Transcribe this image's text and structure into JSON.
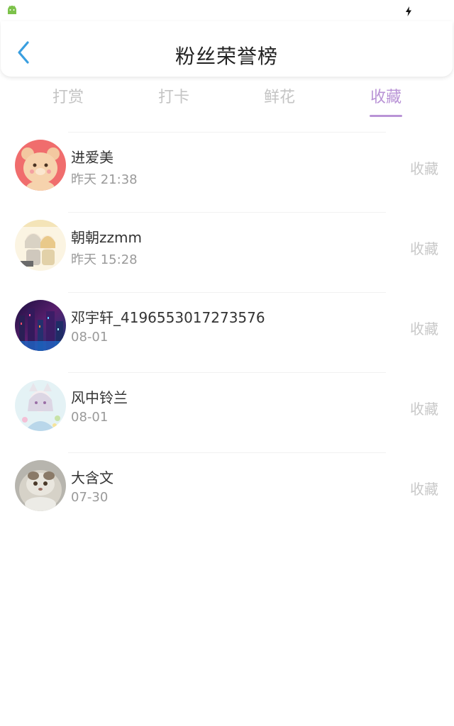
{
  "header": {
    "title": "粉丝荣誉榜"
  },
  "tabs": [
    {
      "label": "打赏",
      "active": false
    },
    {
      "label": "打卡",
      "active": false
    },
    {
      "label": "鲜花",
      "active": false
    },
    {
      "label": "收藏",
      "active": true
    }
  ],
  "colors": {
    "accent": "#b993d6",
    "back_arrow": "#3a9fe0",
    "tab_inactive": "#c4c4c4",
    "secondary_text": "#9a9a9a"
  },
  "fans": [
    {
      "name": "进爱美",
      "time": "昨天 21:38",
      "action": "收藏",
      "avatar": "bear-avatar"
    },
    {
      "name": "朝朝zzmm",
      "time": "昨天 15:28",
      "action": "收藏",
      "avatar": "anime-couple-avatar"
    },
    {
      "name": "邓宇轩_4196553017273576",
      "time": "08-01",
      "action": "收藏",
      "avatar": "city-night-avatar"
    },
    {
      "name": "风中铃兰",
      "time": "08-01",
      "action": "收藏",
      "avatar": "anime-cat-girl-avatar"
    },
    {
      "name": "大含文",
      "time": "07-30",
      "action": "收藏",
      "avatar": "persian-cat-avatar"
    }
  ]
}
